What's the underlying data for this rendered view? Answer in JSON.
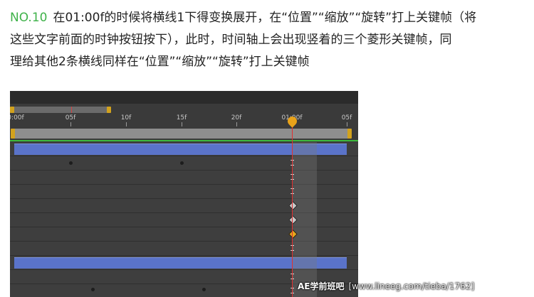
{
  "instruction": {
    "step": "NO.10",
    "line1": "在01:00f的时候将横线1下得变换展开，在“位置”“缩放”“旋转”打上关键帧（将",
    "line2": "这些文字前面的时钟按钮按下），此时，时间轴上会出现竖着的三个菱形关键帧，同",
    "line3": "理给其他2条横线同样在“位置”“缩放”“旋转”打上关键帧"
  },
  "timeline": {
    "ticks": [
      "0:00f",
      "05f",
      "10f",
      "15f",
      "20f",
      "01:00f",
      "05f"
    ],
    "current_time": "01:00f",
    "colors": {
      "layer_bar": "#5a73c9",
      "keyframe": "#e6a61c",
      "playhead": "#e23030",
      "work_area": "#3cba3c"
    }
  },
  "watermark": {
    "brand": "AE学前班吧",
    "url": "[www.lineeg.com/tieba/1762]"
  }
}
